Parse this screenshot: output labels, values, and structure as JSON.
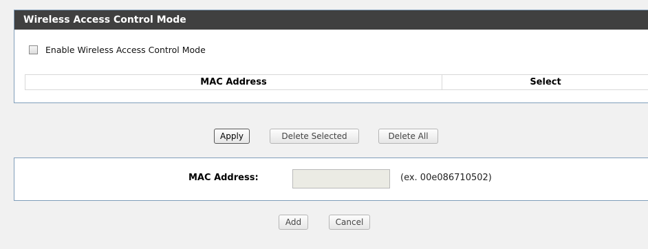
{
  "section": {
    "title": "Wireless Access Control Mode",
    "enable_label": "Enable Wireless Access Control Mode",
    "enabled": false
  },
  "table": {
    "headers": [
      "MAC Address",
      "Select"
    ]
  },
  "actions": {
    "apply": "Apply",
    "delete_selected": "Delete Selected",
    "delete_all": "Delete All"
  },
  "form": {
    "mac_label": "MAC Address:",
    "mac_value": "",
    "hint": "(ex. 00e086710502)",
    "add": "Add",
    "cancel": "Cancel"
  }
}
